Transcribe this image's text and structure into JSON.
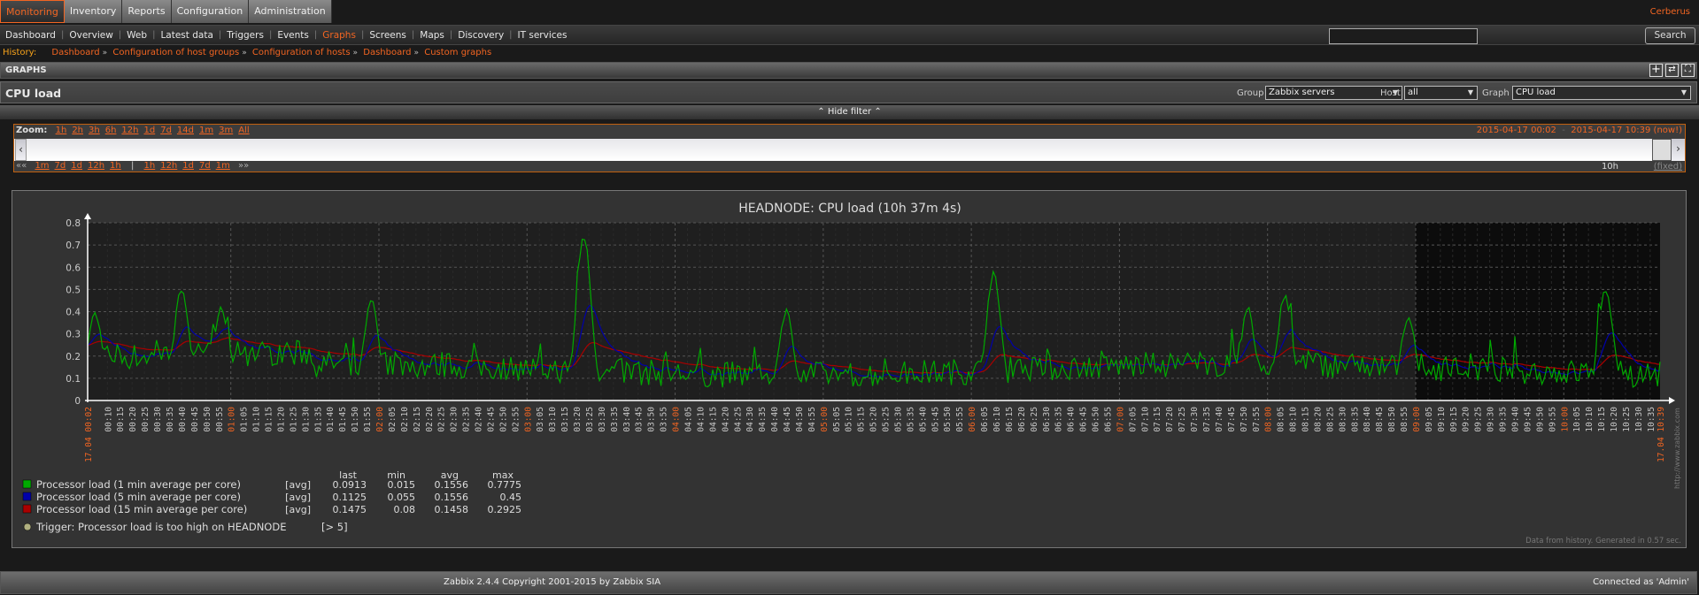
{
  "topnav": {
    "tabs": [
      {
        "label": "Monitoring",
        "active": true
      },
      {
        "label": "Inventory",
        "active": false
      },
      {
        "label": "Reports",
        "active": false
      },
      {
        "label": "Configuration",
        "active": false
      },
      {
        "label": "Administration",
        "active": false
      }
    ],
    "user_link": "Cerberus"
  },
  "subnav": {
    "items": [
      {
        "label": "Dashboard",
        "active": false
      },
      {
        "label": "Overview",
        "active": false
      },
      {
        "label": "Web",
        "active": false
      },
      {
        "label": "Latest data",
        "active": false
      },
      {
        "label": "Triggers",
        "active": false
      },
      {
        "label": "Events",
        "active": false
      },
      {
        "label": "Graphs",
        "active": true
      },
      {
        "label": "Screens",
        "active": false
      },
      {
        "label": "Maps",
        "active": false
      },
      {
        "label": "Discovery",
        "active": false
      },
      {
        "label": "IT services",
        "active": false
      }
    ],
    "search_value": "",
    "search_button": "Search"
  },
  "history": {
    "label": "History:",
    "crumbs": [
      "Dashboard",
      "Configuration of host groups",
      "Configuration of hosts",
      "Dashboard",
      "Custom graphs"
    ],
    "separator": "»"
  },
  "section": {
    "title": "GRAPHS",
    "icons": [
      "add-to-favourites-icon",
      "refresh-icon",
      "fullscreen-icon"
    ],
    "icon_glyphs": [
      "+",
      "⇄",
      "⛶"
    ]
  },
  "subheader": {
    "title": "CPU load",
    "filters": [
      {
        "label": "Group",
        "value": "Zabbix servers"
      },
      {
        "label": "Host",
        "value": "all"
      },
      {
        "label": "Graph",
        "value": "CPU load"
      }
    ]
  },
  "filter_toggle": "Hide filter",
  "scrollbar": {
    "zoom_label": "Zoom:",
    "zoom_links": [
      "1h",
      "2h",
      "3h",
      "6h",
      "12h",
      "1d",
      "7d",
      "14d",
      "1m",
      "3m",
      "All"
    ],
    "period_from": "2015-04-17 00:02",
    "period_dash": "-",
    "period_to": "2015-04-17 10:39",
    "period_now": "(now!)",
    "back_arrows": "««",
    "back_links": [
      "1m",
      "7d",
      "1d",
      "12h",
      "1h"
    ],
    "pipe": "|",
    "fwd_links": [
      "1h",
      "12h",
      "1d",
      "7d",
      "1m"
    ],
    "fwd_arrows": "»»",
    "period_length": "10h",
    "fixed_label": "(fixed)"
  },
  "chart_data": {
    "type": "line",
    "title": "HEADNODE: CPU load (10h 37m 4s)",
    "xlabel": "",
    "ylabel": "",
    "ylim": [
      0,
      0.8
    ],
    "y_ticks": [
      "0",
      "0.1",
      "0.2",
      "0.3",
      "0.4",
      "0.5",
      "0.6",
      "0.7",
      "0.8"
    ],
    "x_range": [
      "17.04 00:02",
      "17.04 10:39"
    ],
    "x_start_label": "17.04 00:02",
    "x_end_label": "17.04 10:39",
    "x_hour_labels": [
      "01:00",
      "02:00",
      "03:00",
      "04:00",
      "05:00",
      "06:00",
      "07:00",
      "08:00",
      "09:00",
      "10:00"
    ],
    "x_tick_step_minutes": 5,
    "grid": true,
    "shaded_from": "09:00",
    "watermark": "http://www.zabbix.com",
    "series": [
      {
        "name": "Processor load (1 min average per core)",
        "func": "[avg]",
        "color": "#00aa00",
        "last": "0.0913",
        "min": "0.015",
        "avg": "0.1556",
        "max": "0.7775"
      },
      {
        "name": "Processor load (5 min average per core)",
        "func": "[avg]",
        "color": "#0000aa",
        "last": "0.1125",
        "min": "0.055",
        "avg": "0.1556",
        "max": "0.45"
      },
      {
        "name": "Processor load (15 min average per core)",
        "func": "[avg]",
        "color": "#aa0000",
        "last": "0.1475",
        "min": "0.08",
        "avg": "0.1458",
        "max": "0.2925"
      }
    ],
    "peaks_1min": [
      {
        "t": "00:05",
        "v": 0.39
      },
      {
        "t": "00:40",
        "v": 0.5
      },
      {
        "t": "00:56",
        "v": 0.41
      },
      {
        "t": "01:57",
        "v": 0.46
      },
      {
        "t": "03:23",
        "v": 0.74
      },
      {
        "t": "04:45",
        "v": 0.4
      },
      {
        "t": "06:09",
        "v": 0.57
      },
      {
        "t": "07:52",
        "v": 0.41
      },
      {
        "t": "08:07",
        "v": 0.47
      },
      {
        "t": "08:57",
        "v": 0.38
      },
      {
        "t": "10:17",
        "v": 0.5
      }
    ],
    "legend_headers": [
      "last",
      "min",
      "avg",
      "max"
    ],
    "trigger": {
      "label": "Trigger: Processor load is too high on HEADNODE",
      "threshold": "[> 5]",
      "color": "#b0b080"
    },
    "footnote": "Data from history. Generated in 0.57 sec."
  },
  "footer": {
    "copyright": "Zabbix 2.4.4 Copyright 2001-2015 by Zabbix SIA",
    "connected": "Connected as 'Admin'"
  }
}
